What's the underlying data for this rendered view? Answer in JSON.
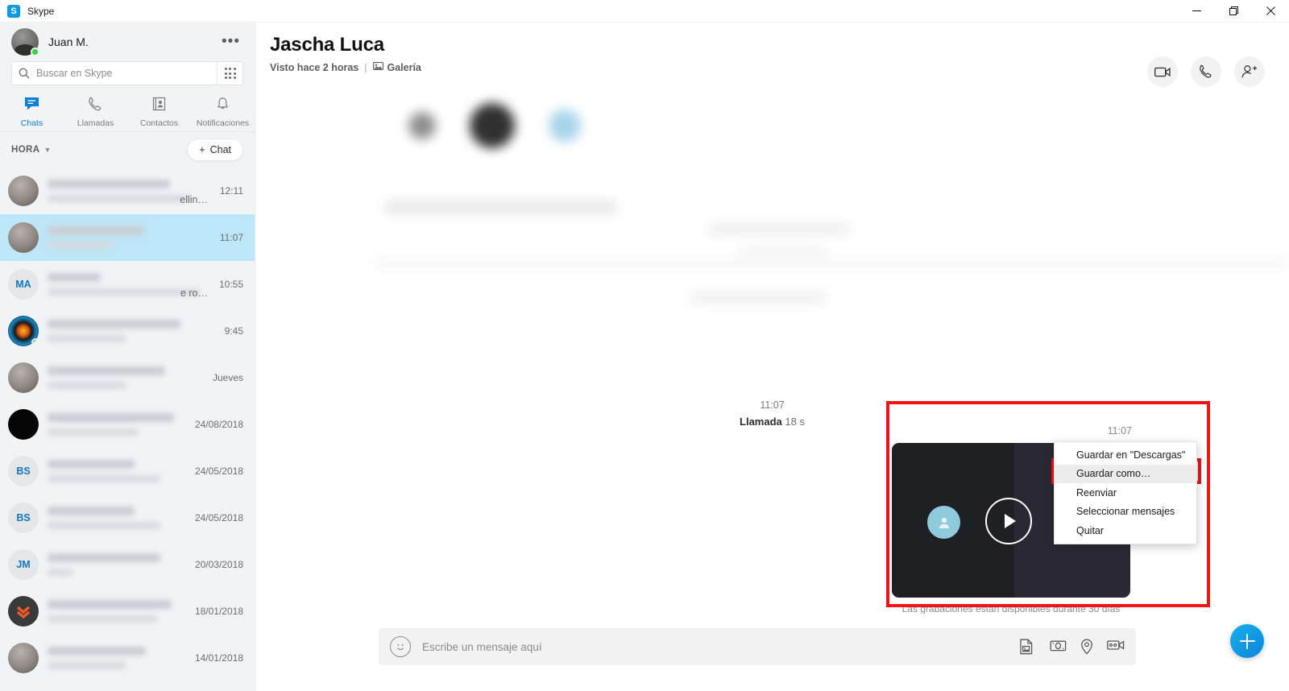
{
  "window": {
    "app_title": "Skype",
    "logo_letter": "S",
    "controls": {
      "minimize": "minimize-button",
      "restore": "restore-button",
      "close": "close-button"
    }
  },
  "sidebar": {
    "profile": {
      "name": "Juan M.",
      "presence": "online",
      "more_label": "•••"
    },
    "search": {
      "placeholder": "Buscar en Skype",
      "value": "",
      "dialpad_icon": "dialpad-icon"
    },
    "tabs": [
      {
        "label": "Chats",
        "icon": "chat-icon",
        "active": true
      },
      {
        "label": "Llamadas",
        "icon": "phone-icon",
        "active": false
      },
      {
        "label": "Contactos",
        "icon": "contacts-icon",
        "active": false
      },
      {
        "label": "Notificaciones",
        "icon": "bell-icon",
        "active": false
      }
    ],
    "list_header": {
      "sort_label": "HORA",
      "chevron_icon": "chevron-down-icon",
      "new_chat_label": "Chat",
      "new_chat_plus": "+"
    },
    "chats": [
      {
        "time": "12:11",
        "avatar_type": "photo",
        "avatar_text": "",
        "selected": false,
        "presence": false,
        "preview_tail": "ellin…"
      },
      {
        "time": "11:07",
        "avatar_type": "photo",
        "avatar_text": "",
        "selected": true,
        "presence": false,
        "preview_tail": ""
      },
      {
        "time": "10:55",
        "avatar_type": "initials",
        "avatar_text": "MA",
        "selected": false,
        "presence": false,
        "preview_tail": "e ro…"
      },
      {
        "time": "9:45",
        "avatar_type": "target",
        "avatar_text": "",
        "selected": false,
        "presence": true,
        "preview_tail": ""
      },
      {
        "time": "Jueves",
        "avatar_type": "photo",
        "avatar_text": "",
        "selected": false,
        "presence": false,
        "preview_tail": ""
      },
      {
        "time": "24/08/2018",
        "avatar_type": "black",
        "avatar_text": "",
        "selected": false,
        "presence": false,
        "preview_tail": ""
      },
      {
        "time": "24/05/2018",
        "avatar_type": "initials",
        "avatar_text": "BS",
        "selected": false,
        "presence": false,
        "preview_tail": ""
      },
      {
        "time": "24/05/2018",
        "avatar_type": "initials",
        "avatar_text": "BS",
        "selected": false,
        "presence": false,
        "preview_tail": ""
      },
      {
        "time": "20/03/2018",
        "avatar_type": "initials",
        "avatar_text": "JM",
        "selected": false,
        "presence": false,
        "preview_tail": ""
      },
      {
        "time": "18/01/2018",
        "avatar_type": "chevrons",
        "avatar_text": "",
        "selected": false,
        "presence": false,
        "preview_tail": ""
      },
      {
        "time": "14/01/2018",
        "avatar_type": "photo",
        "avatar_text": "",
        "selected": false,
        "presence": false,
        "preview_tail": ""
      }
    ]
  },
  "conversation": {
    "title": "Jascha Luca",
    "last_seen": "Visto hace 2 horas",
    "separator": "|",
    "gallery_label": "Galería",
    "gallery_icon": "gallery-icon",
    "actions": [
      {
        "name": "video-call-button",
        "icon": "video-camera-icon"
      },
      {
        "name": "voice-call-button",
        "icon": "phone-handset-icon"
      },
      {
        "name": "add-people-button",
        "icon": "add-person-icon"
      }
    ],
    "call_entry": {
      "time": "11:07",
      "label": "Llamada",
      "duration": "18 s"
    },
    "video_message": {
      "time": "11:07",
      "caption": "Las grabaciones están disponibles durante 30 días",
      "play_icon": "play-icon",
      "avatar_icon": "person-icon"
    }
  },
  "context_menu": {
    "items": [
      {
        "label": "Guardar en \"Descargas\"",
        "highlighted": false
      },
      {
        "label": "Guardar como…",
        "highlighted": true
      },
      {
        "label": "Reenviar",
        "highlighted": false
      },
      {
        "label": "Seleccionar mensajes",
        "highlighted": false
      },
      {
        "label": "Quitar",
        "highlighted": false
      }
    ]
  },
  "compose": {
    "placeholder": "Escribe un mensaje aquí",
    "value": "",
    "emoji_icon": "emoji-icon",
    "tools": [
      {
        "name": "send-image-button",
        "icon": "image-icon"
      },
      {
        "name": "send-money-button",
        "icon": "money-icon"
      },
      {
        "name": "send-location-button",
        "icon": "location-pin-icon"
      },
      {
        "name": "send-video-button",
        "icon": "video-message-icon"
      }
    ],
    "fab_icon": "plus-icon"
  },
  "colors": {
    "accent": "#0b7fd4",
    "selected_row": "#bde6f7",
    "annotation_red": "#f01414",
    "menu_highlight": "#ececec",
    "sidebar_bg": "#f1f4f7"
  }
}
